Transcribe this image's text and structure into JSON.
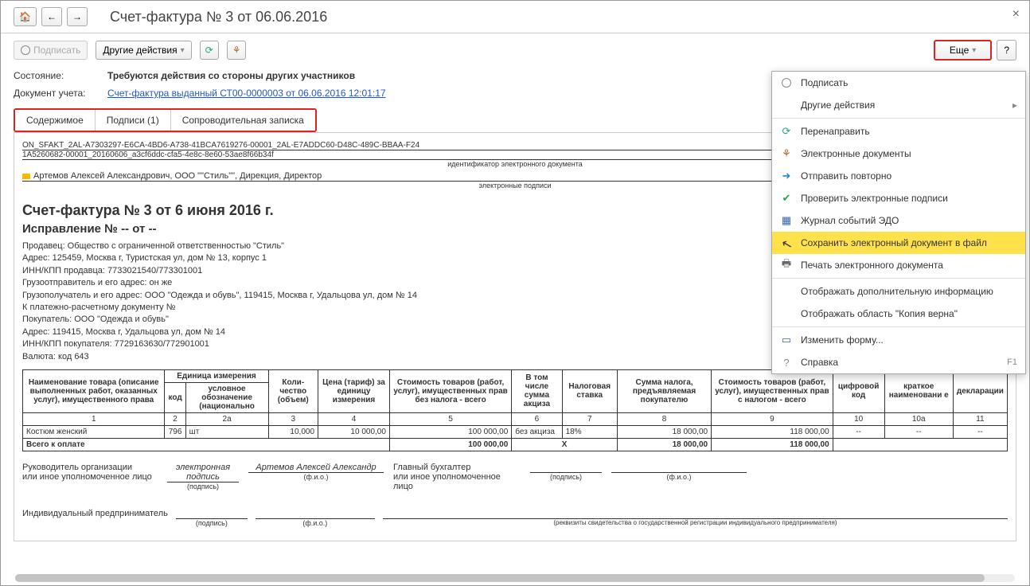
{
  "header": {
    "title": "Счет-фактура № 3 от 06.06.2016"
  },
  "toolbar": {
    "sign": "Подписать",
    "other_actions": "Другие действия",
    "more": "Еще",
    "help": "?"
  },
  "state": {
    "label": "Состояние:",
    "value": "Требуются действия со стороны других участников"
  },
  "doc_ref": {
    "label": "Документ учета:",
    "link": "Счет-фактура выданный СТ00-0000003 от 06.06.2016 12:01:17"
  },
  "tabs": {
    "content": "Содержимое",
    "signatures": "Подписи (1)",
    "note": "Сопроводительная записка"
  },
  "edoc": {
    "id_line1": "ON_SFAKT_2AL-A7303297-E6CA-4BD6-A738-41BCA7619276-00001_2AL-E7ADDC60-D48C-489C-BBAA-F24",
    "id_line2": "1A5260682-00001_20160606_a3cf6ddc-cfa5-4e8c-8e60-53ae8f66b34f",
    "id_sub": "идентификатор электронного документа",
    "signer": "Артемов Алексей Александрович, ООО \"\"Стиль\"\", Дирекция, Директор",
    "sign_sub": "электронные подписи"
  },
  "document": {
    "title": "Счет-фактура № 3 от 6 июня 2016 г.",
    "correction": "Исправление № -- от --",
    "seller": "Продавец: Общество с ограниченной ответственностью \"Стиль\"",
    "seller_addr": "Адрес: 125459, Москва г, Туристская ул, дом № 13, корпус 1",
    "seller_inn": "ИНН/КПП продавца: 7733021540/773301001",
    "shipper": "Грузоотправитель и его адрес: он же",
    "consignee": "Грузополучатель и его адрес: ООО \"Одежда и обувь\", 119415, Москва г, Удальцова ул, дом № 14",
    "payment": "К платежно-расчетному документу №",
    "buyer": "Покупатель: ООО \"Одежда и обувь\"",
    "buyer_addr": "Адрес: 119415, Москва г, Удальцова ул, дом № 14",
    "buyer_inn": "ИНН/КПП покупателя: 7729163630/772901001",
    "currency": "Валюта: код 643"
  },
  "table": {
    "headers": {
      "name": "Наименование товара (описание выполненных работ, оказанных услуг), имущественного права",
      "unit": "Единица измерения",
      "code": "код",
      "unit_name": "условное обозначение (национально",
      "qty": "Коли-\nчество (объем)",
      "price": "Цена (тариф) за единицу измерения",
      "cost_no_tax": "Стоимость товаров (работ, услуг), имущественных прав без налога - всего",
      "excise": "В том числе сумма акциза",
      "tax_rate": "Налоговая ставка",
      "tax_sum": "Сумма налога, предъявляемая покупателю",
      "cost_with_tax": "Стоимость товаров (работ, услуг), имущественных прав с налогом - всего",
      "digital_code": "цифровой код",
      "short_name": "краткое наименовани е",
      "decl": "декларации"
    },
    "cols": [
      "1",
      "2",
      "2а",
      "3",
      "4",
      "5",
      "6",
      "7",
      "8",
      "9",
      "10",
      "10а",
      "11"
    ],
    "rows": [
      {
        "name": "Костюм женский",
        "code": "796",
        "unit": "шт",
        "qty": "10,000",
        "price": "10 000,00",
        "cost": "100 000,00",
        "excise": "без акциза",
        "rate": "18%",
        "tax": "18 000,00",
        "total": "118 000,00",
        "dc": "--",
        "sn": "--",
        "decl": "--"
      }
    ],
    "total_label": "Всего к оплате",
    "total_cost": "100 000,00",
    "total_x": "X",
    "total_tax": "18 000,00",
    "total_sum": "118 000,00"
  },
  "signatures": {
    "head": "Руководитель организации",
    "or_auth": "или иное уполномоченное лицо",
    "chief_acc": "Главный бухгалтер",
    "e_sign": "электронная подпись",
    "name": "Артемов Алексей Александр",
    "sign_lbl": "(подпись)",
    "fio_lbl": "(ф.и.о.)",
    "ip": "Индивидуальный предприниматель",
    "ip_note": "(реквизиты свидетельства о государственной регистрации индивидуального предпринимателя)"
  },
  "menu": {
    "sign": "Подписать",
    "other": "Другие действия",
    "redirect": "Перенаправить",
    "edocs": "Электронные документы",
    "resend": "Отправить повторно",
    "check_sign": "Проверить электронные подписи",
    "journal": "Журнал событий ЭДО",
    "save_file": "Сохранить электронный документ в файл",
    "print": "Печать электронного документа",
    "show_info": "Отображать дополнительную информацию",
    "show_copy": "Отображать область \"Копия верна\"",
    "change_form": "Изменить форму...",
    "help": "Справка",
    "help_key": "F1"
  }
}
